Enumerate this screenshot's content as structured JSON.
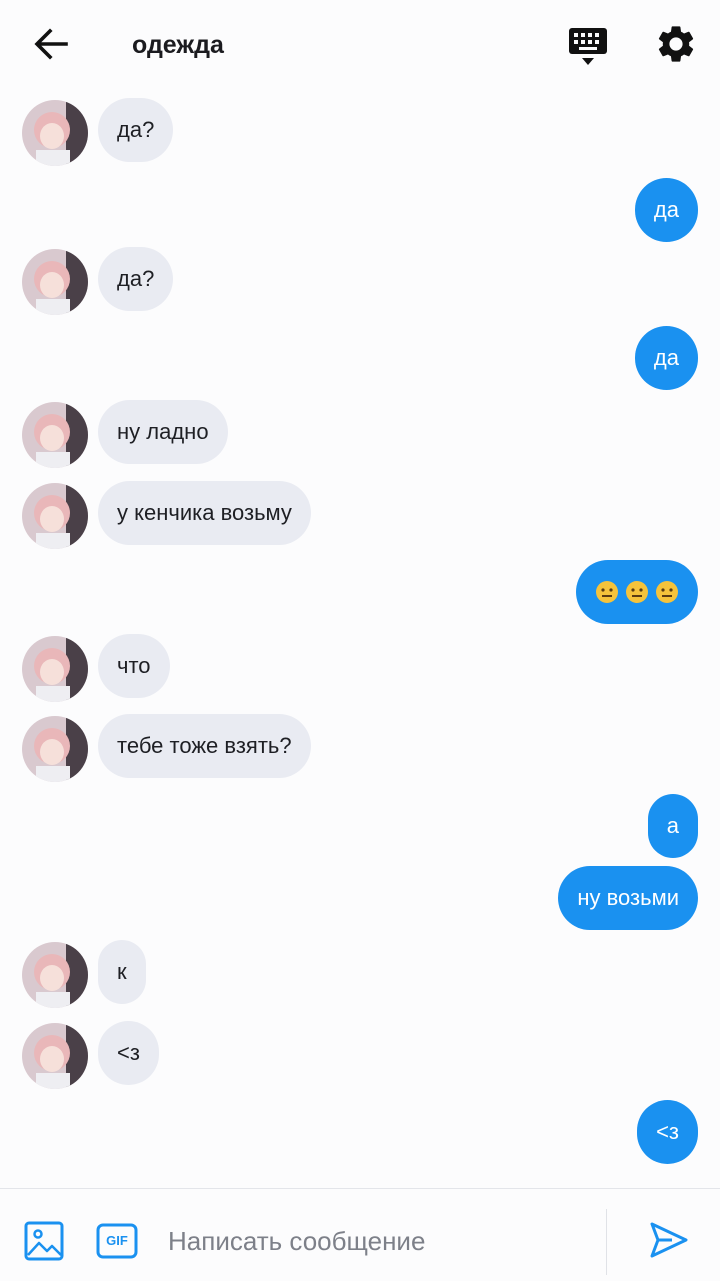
{
  "header": {
    "title": "одежда",
    "back_icon": "arrow-left-icon",
    "keyboard_icon": "keyboard-hide-icon",
    "settings_icon": "gear-icon"
  },
  "messages": [
    {
      "from": "other",
      "text": "да?"
    },
    {
      "from": "me",
      "text": "да"
    },
    {
      "from": "other",
      "text": "да?"
    },
    {
      "from": "me",
      "text": "да"
    },
    {
      "from": "other",
      "text": "ну ладно"
    },
    {
      "from": "other",
      "text": "у кенчика возьму"
    },
    {
      "from": "me",
      "text": "😐😐😐"
    },
    {
      "from": "other",
      "text": "что"
    },
    {
      "from": "other",
      "text": "тебе тоже взять?"
    },
    {
      "from": "me",
      "text": "а"
    },
    {
      "from": "me",
      "text": "ну возьми"
    },
    {
      "from": "other",
      "text": "к"
    },
    {
      "from": "other",
      "text": "<з"
    },
    {
      "from": "me",
      "text": "<з"
    }
  ],
  "composer": {
    "placeholder": "Написать сообщение",
    "value": "",
    "gif_label": "GIF",
    "image_icon": "image-icon",
    "send_icon": "send-icon"
  },
  "colors": {
    "outgoing_bubble": "#1a91f0",
    "incoming_bubble": "#e9ebf2",
    "accent": "#1a91f0"
  }
}
